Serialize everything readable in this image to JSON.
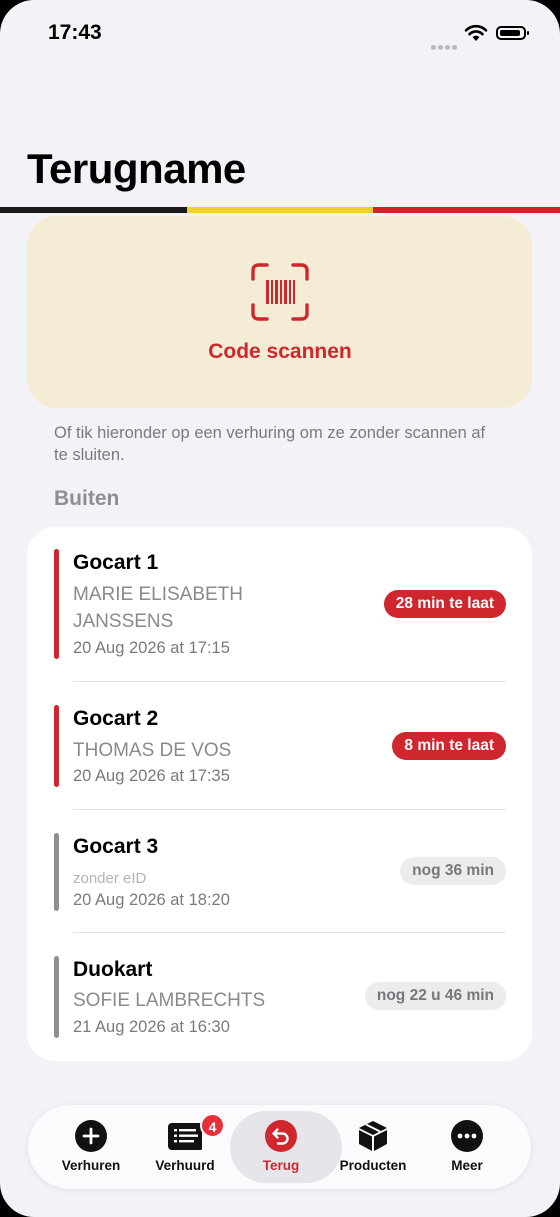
{
  "status_bar": {
    "time": "17:43"
  },
  "page_title": "Terugname",
  "flag_colors": [
    "#1a1a1a",
    "#f0cf2e",
    "#d2232a"
  ],
  "scan": {
    "label": "Code scannen",
    "icon": "barcode-scan-icon"
  },
  "hint": "Of tik hieronder op een verhuring om ze zonder scannen af te sluiten.",
  "section_title": "Buiten",
  "rentals": [
    {
      "name": "Gocart 1",
      "customer": "MARIE ELISABETH JANSSENS",
      "date": "20 Aug 2026 at 17:15",
      "status": "28 min te laat",
      "late": true
    },
    {
      "name": "Gocart 2",
      "customer": "THOMAS DE VOS",
      "date": "20 Aug 2026 at 17:35",
      "status": "8 min te laat",
      "late": true
    },
    {
      "name": "Gocart 3",
      "customer": "zonder eID",
      "date": "20 Aug 2026 at 18:20",
      "status": "nog 36 min",
      "late": false
    },
    {
      "name": "Duokart",
      "customer": "SOFIE LAMBRECHTS",
      "date": "21 Aug 2026 at 16:30",
      "status": "nog 22 u 46 min",
      "late": false
    }
  ],
  "tabbar": {
    "tabs": [
      {
        "label": "Verhuren",
        "icon": "plus-circle-icon"
      },
      {
        "label": "Verhuurd",
        "icon": "list-icon",
        "badge": "4"
      },
      {
        "label": "Terug",
        "icon": "return-arrow-icon",
        "active": true
      },
      {
        "label": "Producten",
        "icon": "package-icon"
      },
      {
        "label": "Meer",
        "icon": "more-dots-icon"
      }
    ]
  },
  "colors": {
    "accent": "#d0262e",
    "late_bar": "#d0262e",
    "ok_bar": "#8e8e93",
    "scan_card": "#f4ecd4"
  }
}
